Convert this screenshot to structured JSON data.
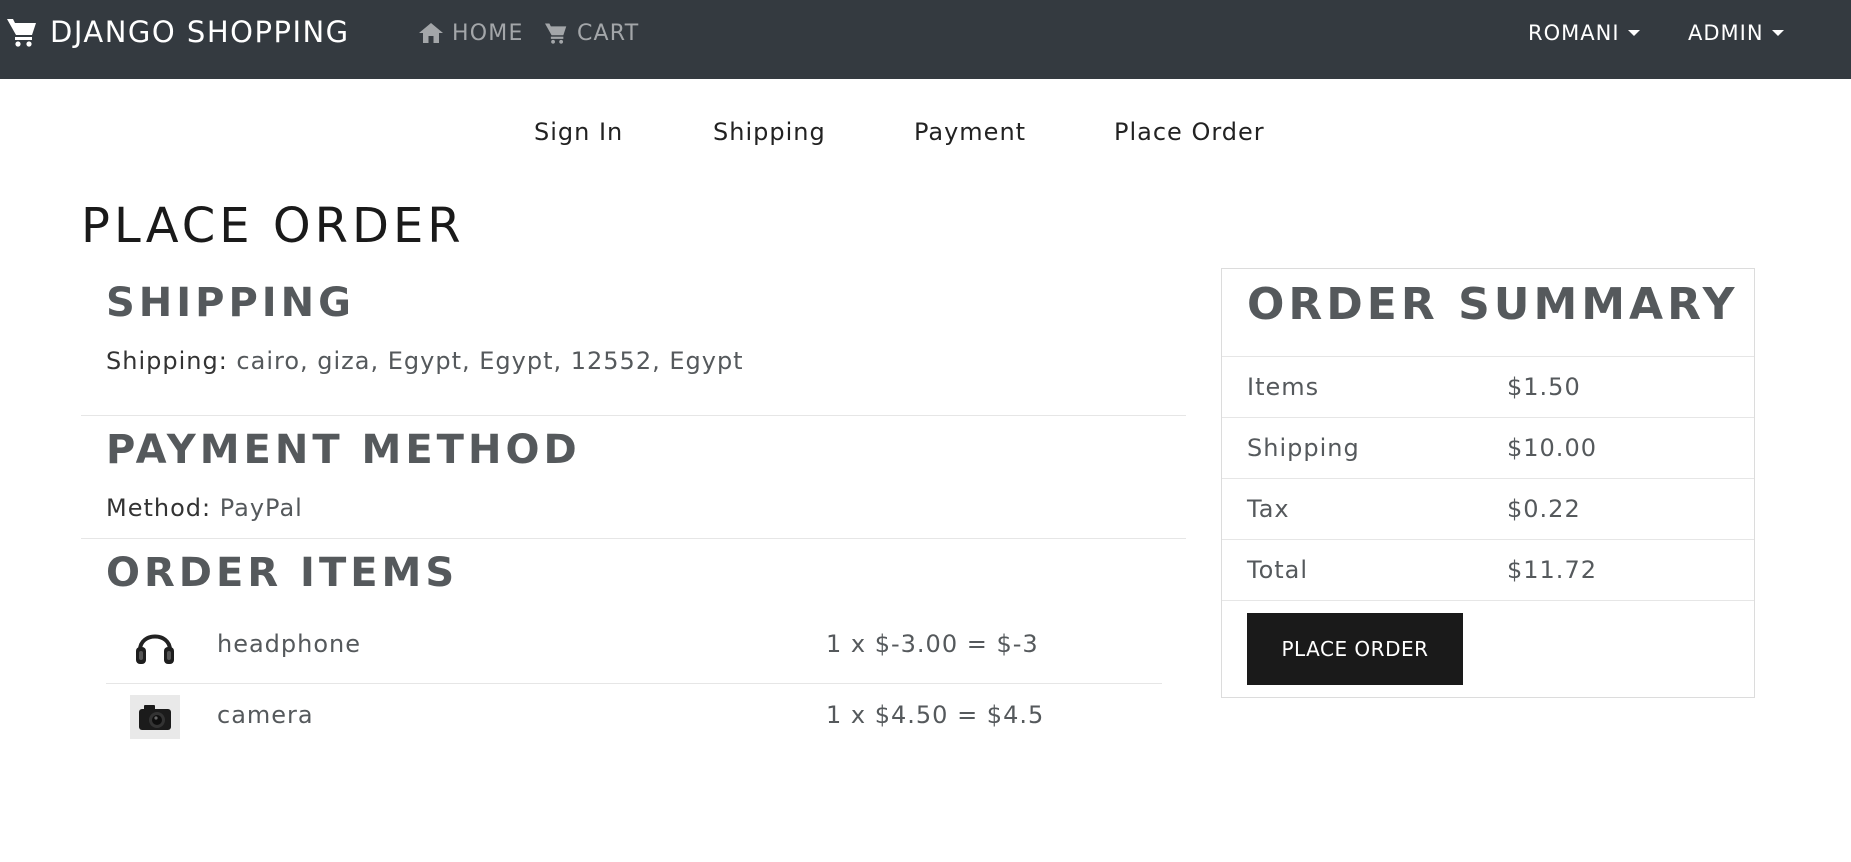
{
  "nav": {
    "brand": "DJANGO SHOPPING",
    "links": [
      {
        "label": "HOME",
        "icon": "home-icon"
      },
      {
        "label": "CART",
        "icon": "cart-icon"
      }
    ],
    "dropdowns": [
      "ROMANI",
      "ADMIN"
    ]
  },
  "steps": [
    "Sign In",
    "Shipping",
    "Payment",
    "Place Order"
  ],
  "page_title": "PLACE ORDER",
  "shipping": {
    "title": "SHIPPING",
    "label": "Shipping:",
    "value": " cairo, giza, Egypt, Egypt, 12552, Egypt"
  },
  "payment": {
    "title": "PAYMENT METHOD",
    "label": "Method:",
    "value": " PayPal"
  },
  "items": {
    "title": "ORDER ITEMS",
    "rows": [
      {
        "name": "headphone",
        "calc": "1 x $-3.00 = $-3",
        "image": "headphone-image"
      },
      {
        "name": "camera",
        "calc": "1 x $4.50 = $4.5",
        "image": "camera-image"
      }
    ]
  },
  "summary": {
    "title": "ORDER SUMMARY",
    "rows": [
      {
        "label": "Items",
        "value": "$1.50"
      },
      {
        "label": "Shipping",
        "value": "$10.00"
      },
      {
        "label": "Tax",
        "value": "$0.22"
      },
      {
        "label": "Total",
        "value": "$11.72"
      }
    ],
    "button": "PLACE ORDER"
  },
  "colors": {
    "navbar": "#343a40",
    "button": "#1a1a1a",
    "text": "#55595c"
  }
}
